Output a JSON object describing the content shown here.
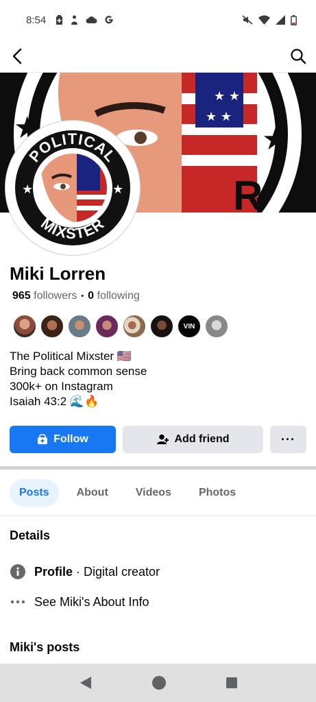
{
  "status": {
    "time": "8:54"
  },
  "profile": {
    "name": "Miki Lorren",
    "followers_count": "965",
    "followers_label": "followers",
    "separator": "•",
    "following_count": "0",
    "following_label": "following",
    "cover_text": "POLITICAL MIXSTER",
    "avatar_text_top": "POLITICAL",
    "avatar_text_bottom": "MIXSTER",
    "bio": [
      "The Political Mixster 🇺🇸",
      "Bring back common sense",
      "300k+ on Instagram",
      "Isaiah 43:2 🌊🔥"
    ],
    "friend_avatar_vin": "VIN"
  },
  "actions": {
    "follow": "Follow",
    "add_friend": "Add friend",
    "more": "···"
  },
  "tabs": [
    {
      "label": "Posts"
    },
    {
      "label": "About"
    },
    {
      "label": "Videos"
    },
    {
      "label": "Photos"
    }
  ],
  "details": {
    "title": "Details",
    "profile_label": "Profile",
    "profile_value": " · Digital creator",
    "about_link": "See Miki's About Info"
  },
  "posts": {
    "title": "Miki's posts"
  },
  "colors": {
    "accent": "#1877f2",
    "secondary_button": "#e4e6eb",
    "tab_active_bg": "#e7f3ff"
  }
}
